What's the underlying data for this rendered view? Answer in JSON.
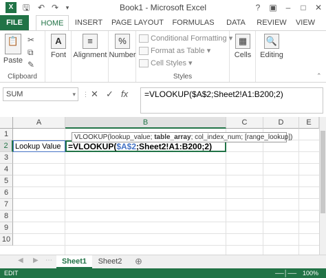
{
  "window": {
    "title": "Book1 - Microsoft Excel",
    "help": "?",
    "minimize": "–",
    "restore": "□",
    "close": "✕",
    "options": "▣"
  },
  "quick_access": {
    "save_icon": "save-icon",
    "undo": "↶",
    "redo": "↷"
  },
  "tabs": [
    "FILE",
    "HOME",
    "INSERT",
    "PAGE LAYOUT",
    "FORMULAS",
    "DATA",
    "REVIEW",
    "VIEW"
  ],
  "ribbon": {
    "clipboard": {
      "paste_label": "Paste",
      "group_label": "Clipboard"
    },
    "font": {
      "label": "Font"
    },
    "alignment": {
      "label": "Alignment"
    },
    "number": {
      "label": "Number",
      "symbol": "%"
    },
    "styles": {
      "conditional": "Conditional Formatting",
      "format_table": "Format as Table",
      "cell_styles": "Cell Styles",
      "group_label": "Styles"
    },
    "cells": {
      "label": "Cells"
    },
    "editing": {
      "label": "Editing"
    }
  },
  "formula_bar": {
    "name_box": "SUM",
    "cancel": "✕",
    "enter": "✓",
    "fx": "fx",
    "formula": "=VLOOKUP($A$2;Sheet2!A1:B200;2)"
  },
  "columns": [
    "A",
    "B",
    "C",
    "D",
    "E"
  ],
  "rows": [
    "1",
    "2",
    "3",
    "4",
    "5",
    "6",
    "7",
    "8",
    "9",
    "10"
  ],
  "cells": {
    "a2": "Lookup Value",
    "b2_prefix": "=VLOOKUP(",
    "b2_ref": "$A$2",
    "b2_suffix": ";Sheet2!A1:B200;2)"
  },
  "tooltip": {
    "fn": "VLOOKUP(",
    "arg1": "lookup_value",
    "sep1": "; ",
    "arg2": "table_array",
    "rest": "; col_index_num; [range_lookup])"
  },
  "sheets": [
    "Sheet1",
    "Sheet2"
  ],
  "status": {
    "mode": "EDIT",
    "zoom": "100%"
  },
  "colors": {
    "accent": "#217346",
    "ref": "#4472c4"
  }
}
